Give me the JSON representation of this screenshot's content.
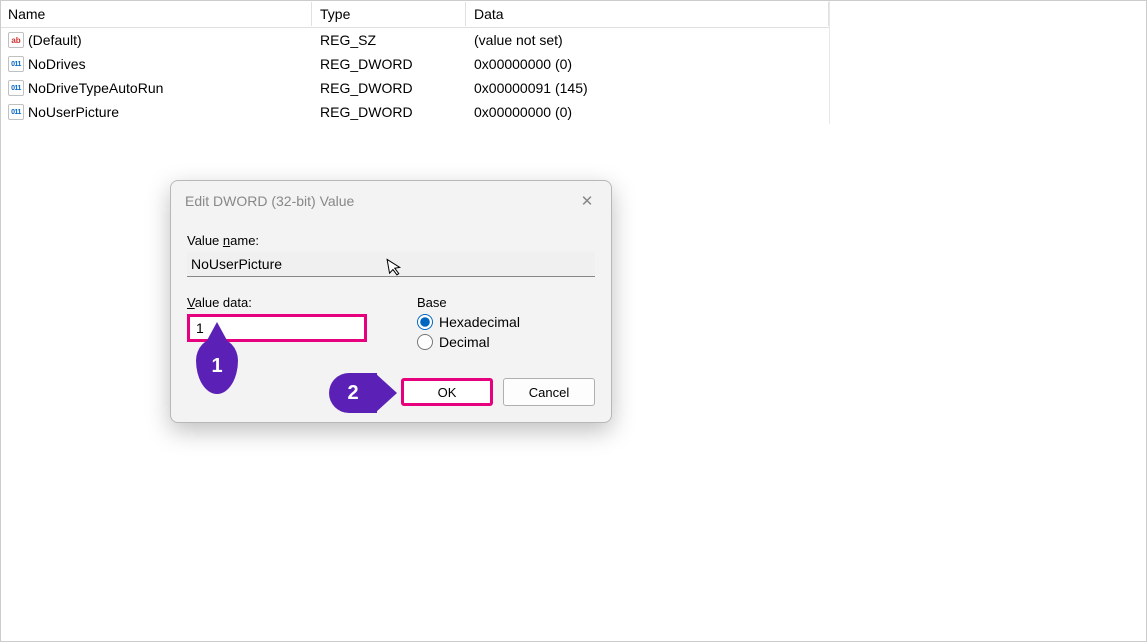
{
  "list": {
    "headers": {
      "name": "Name",
      "type": "Type",
      "data": "Data"
    },
    "rows": [
      {
        "icon": "ab",
        "name": "(Default)",
        "type": "REG_SZ",
        "data": "(value not set)"
      },
      {
        "icon": "dword",
        "name": "NoDrives",
        "type": "REG_DWORD",
        "data": "0x00000000 (0)"
      },
      {
        "icon": "dword",
        "name": "NoDriveTypeAutoRun",
        "type": "REG_DWORD",
        "data": "0x00000091 (145)"
      },
      {
        "icon": "dword",
        "name": "NoUserPicture",
        "type": "REG_DWORD",
        "data": "0x00000000 (0)"
      }
    ]
  },
  "dialog": {
    "title": "Edit DWORD (32-bit) Value",
    "value_name_label": "Value name:",
    "value_name": "NoUserPicture",
    "value_data_label": "Value data:",
    "value_data": "1",
    "base_label": "Base",
    "hex_label": "Hexadecimal",
    "dec_label": "Decimal",
    "base_selected": "hex",
    "ok": "OK",
    "cancel": "Cancel"
  },
  "annotations": {
    "step1": "1",
    "step2": "2"
  }
}
